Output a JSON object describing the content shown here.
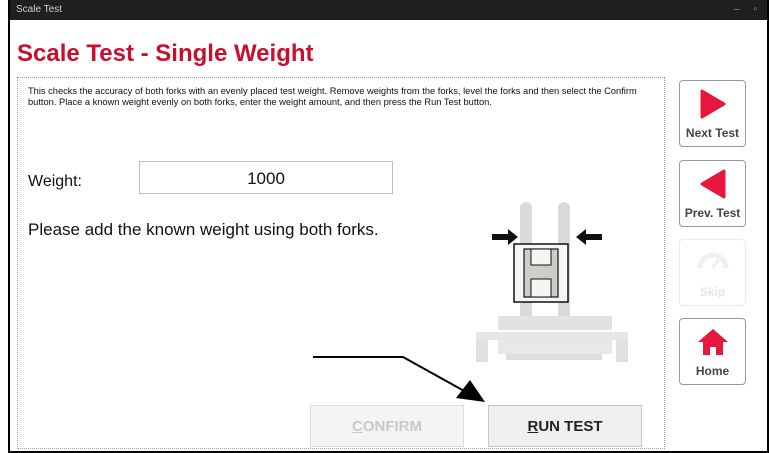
{
  "window": {
    "title": "Scale Test",
    "minimize_glyph": "–",
    "maximize_glyph": "▫"
  },
  "page": {
    "title": "Scale Test - Single Weight",
    "instructions": "This checks the accuracy of both forks with an evenly placed test weight. Remove weights from the forks, level the forks and then select the Confirm button. Place a known weight evenly on both forks, enter the weight amount, and then press the Run Test button.",
    "weight_label": "Weight:",
    "weight_value": "1000",
    "prompt": "Please add the known weight using both forks."
  },
  "buttons": {
    "confirm_first": "C",
    "confirm_rest": "ONFIRM",
    "confirm_enabled": false,
    "run_first": "R",
    "run_rest": "UN TEST",
    "run_enabled": true
  },
  "sidebar": {
    "items": [
      {
        "label": "Next Test",
        "icon": "play-right-icon",
        "enabled": true
      },
      {
        "label": "Prev. Test",
        "icon": "play-left-icon",
        "enabled": true
      },
      {
        "label": "Skip",
        "icon": "gauge-icon",
        "enabled": false
      },
      {
        "label": "Home",
        "icon": "home-icon",
        "enabled": true
      }
    ]
  },
  "colors": {
    "accent": "#c8102e",
    "titlebar": "#1f1f1f",
    "disabled_text": "#c8c8c8"
  }
}
